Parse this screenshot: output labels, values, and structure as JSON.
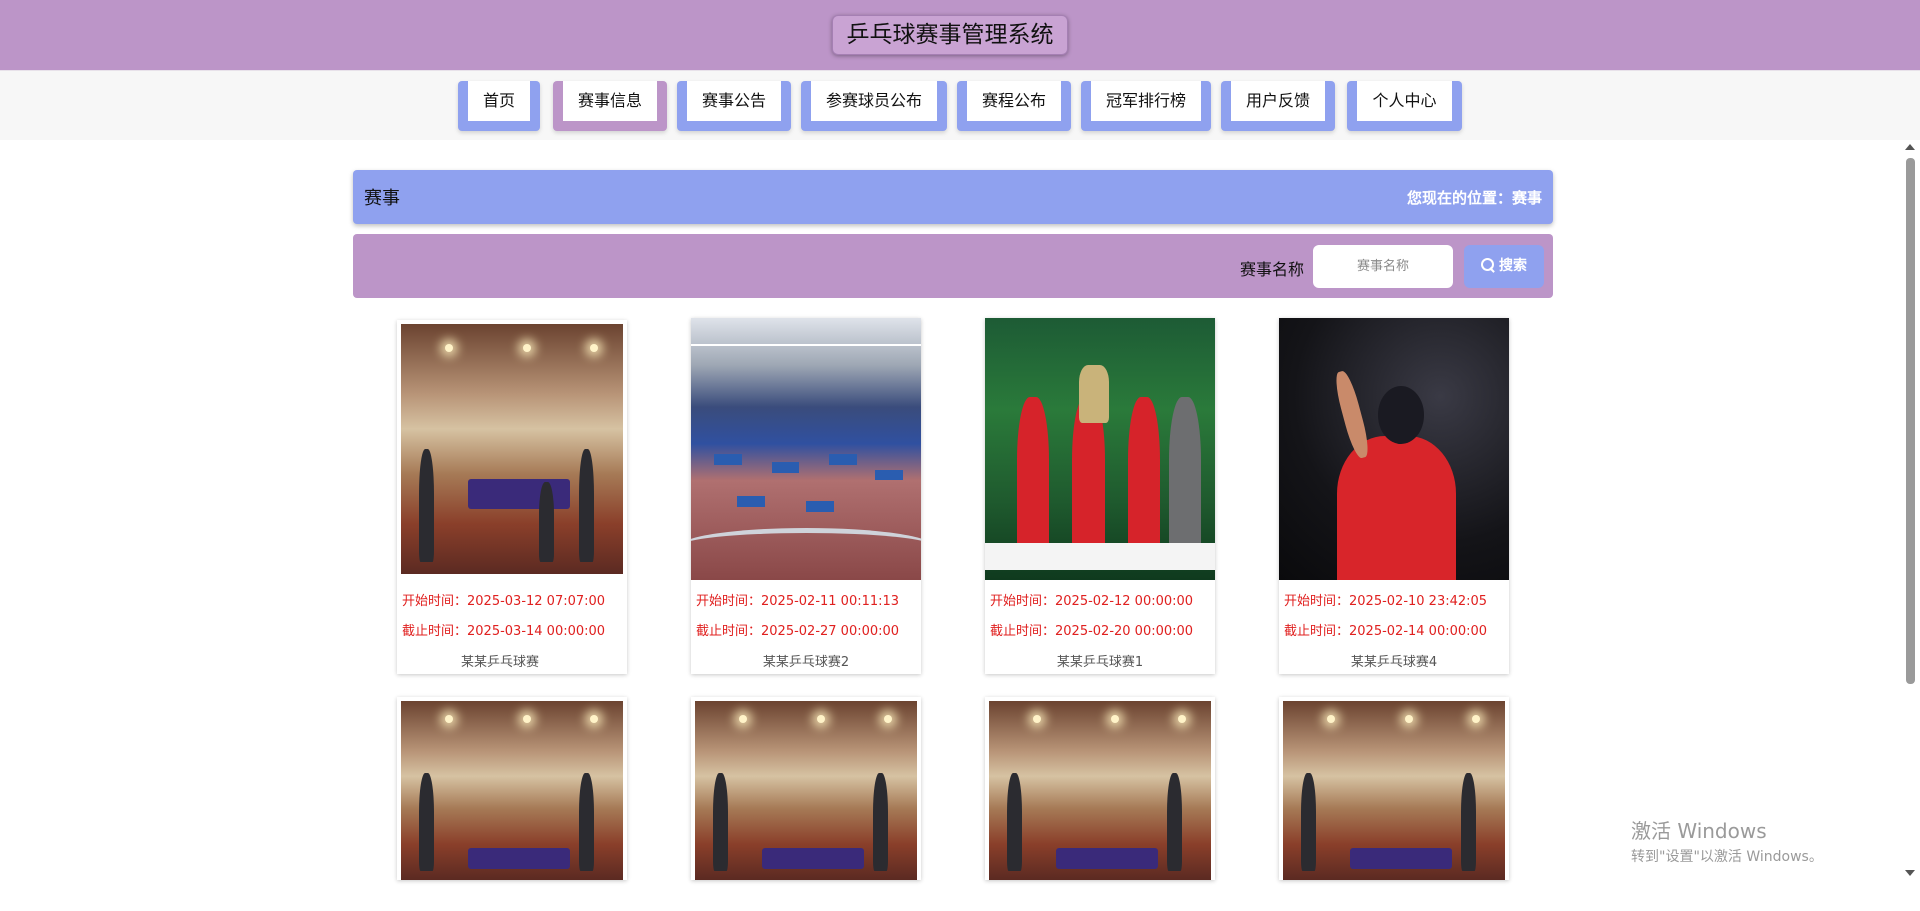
{
  "header": {
    "title": "乒乓球赛事管理系统"
  },
  "nav": {
    "items": [
      "首页",
      "赛事信息",
      "赛事公告",
      "参赛球员公布",
      "赛程公布",
      "冠军排行榜",
      "用户反馈",
      "个人中心"
    ],
    "active": "赛事信息"
  },
  "breadcrumb": {
    "title": "赛事",
    "position": "您现在的位置：赛事"
  },
  "search": {
    "label": "赛事名称",
    "placeholder": "赛事名称",
    "button": "搜索"
  },
  "cards": [
    {
      "start": "开始时间：2025-03-12 07:07:00",
      "end": "截止时间：2025-03-14 00:00:00",
      "name": "某某乒乓球赛"
    },
    {
      "start": "开始时间：2025-02-11 00:11:13",
      "end": "截止时间：2025-02-27 00:00:00",
      "name": "某某乒乓球赛2"
    },
    {
      "start": "开始时间：2025-02-12 00:00:00",
      "end": "截止时间：2025-02-20 00:00:00",
      "name": "某某乒乓球赛1"
    },
    {
      "start": "开始时间：2025-02-10 23:42:05",
      "end": "截止时间：2025-02-14 00:00:00",
      "name": "某某乒乓球赛4"
    }
  ],
  "watermark": {
    "line1": "激活 Windows",
    "line2": "转到\"设置\"以激活 Windows。"
  }
}
